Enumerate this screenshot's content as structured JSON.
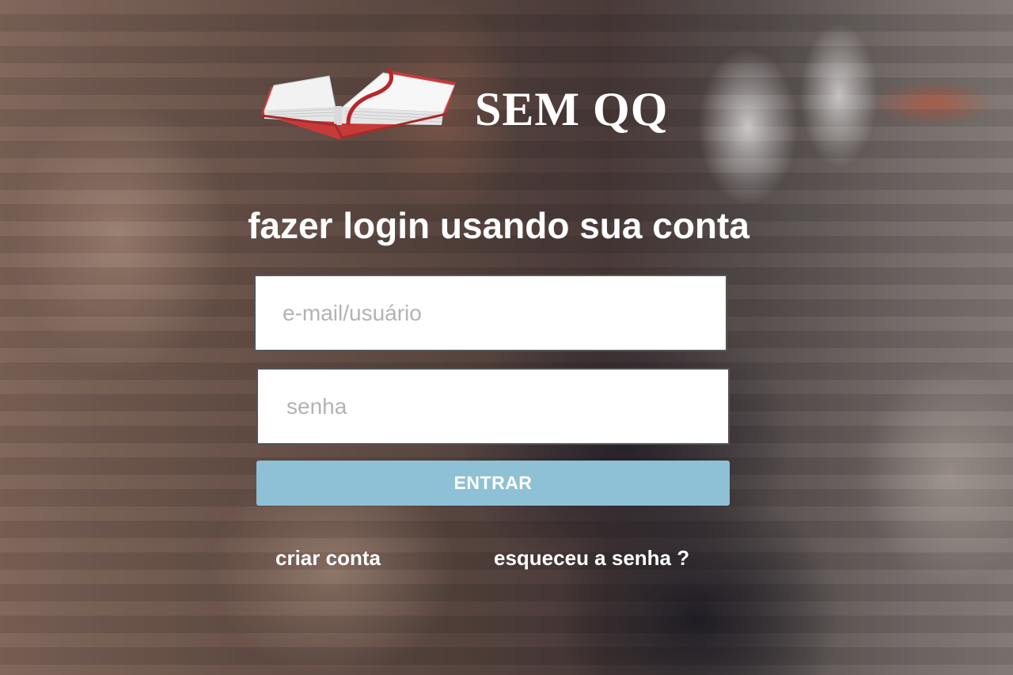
{
  "brand": {
    "name": "SEM QQ",
    "logo_icon": "open-book-icon",
    "colors": {
      "book_accent": "#c73a3a",
      "pages": "#f4f4f4"
    }
  },
  "login": {
    "heading": "fazer login usando sua conta",
    "username_placeholder": "e-mail/usuário",
    "username_value": "",
    "password_placeholder": "senha",
    "password_value": "",
    "submit_label": "ENTRAR",
    "create_account_label": "criar conta",
    "forgot_password_label": "esqueceu a senha ?"
  },
  "colors": {
    "submit_button": "#8fc1d6",
    "text": "#ffffff"
  }
}
